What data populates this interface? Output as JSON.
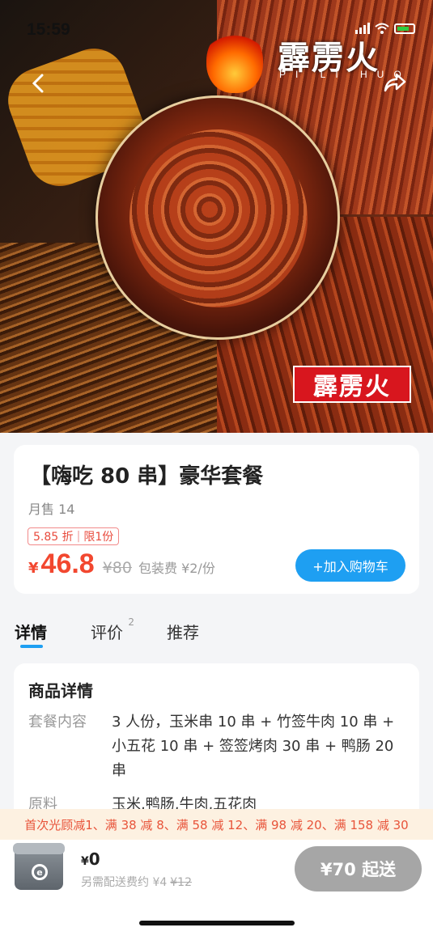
{
  "status": {
    "time": "15:59"
  },
  "hero": {
    "brand_name": "霹雳火",
    "brand_pinyin": "PI LI HUO",
    "stamp_text": "霹雳火"
  },
  "product": {
    "title": "【嗨吃 80 串】豪华套餐",
    "monthly_sales": "月售 14",
    "discount_tag": "5.85 折",
    "limit_tag": "限1份",
    "currency": "¥",
    "price": "46.8",
    "original_price": "¥80",
    "packing_fee": "包装费 ¥2/份",
    "add_to_cart": "+加入购物车"
  },
  "tabs": [
    {
      "label": "详情",
      "count": ""
    },
    {
      "label": "评价",
      "count": "2"
    },
    {
      "label": "推荐",
      "count": ""
    }
  ],
  "detail": {
    "heading": "商品详情",
    "rows": [
      {
        "key": "套餐内容",
        "value": "3 人份，玉米串 10 串 + 竹签牛肉 10 串 + 小五花 10 串 + 签签烤肉 30 串 + 鸭肠 20 串"
      },
      {
        "key": "原料",
        "value": "玉米,鸭肠,牛肉,五花肉"
      }
    ]
  },
  "discount_bar": "首次光顾减1、满 38 减 8、满 58 减 12、满 98 减 20、满 158 减 30",
  "cart": {
    "currency": "¥",
    "total": "0",
    "delivery_fee_label": "另需配送费约 ¥4",
    "delivery_fee_old": "¥12",
    "submit": "¥70 起送"
  },
  "colors": {
    "accent": "#1e9ff2",
    "price": "#f2472f",
    "disabled": "#a6a6a6"
  }
}
